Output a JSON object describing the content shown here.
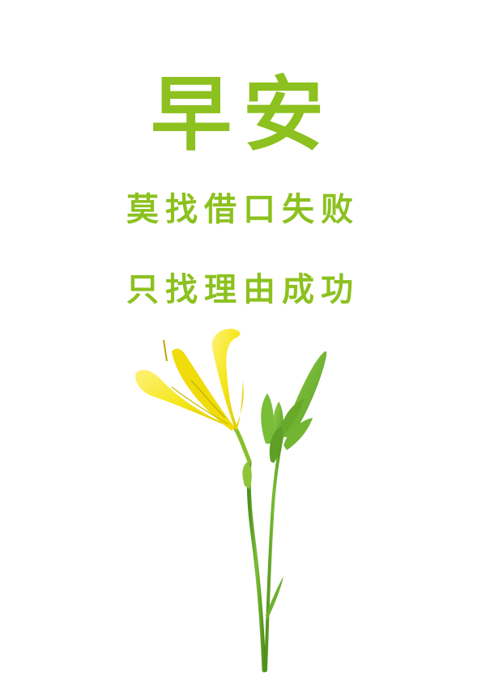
{
  "greeting": {
    "title": "早安",
    "line_1": "莫找借口失败",
    "line_2": "只找理由成功"
  },
  "colors": {
    "text_green": "#8cc11f",
    "petal_yellow": "#f2e400",
    "stem_green": "#6bab2b",
    "background": "#ffffff"
  },
  "image": {
    "subject": "yellow-lily-flower"
  }
}
